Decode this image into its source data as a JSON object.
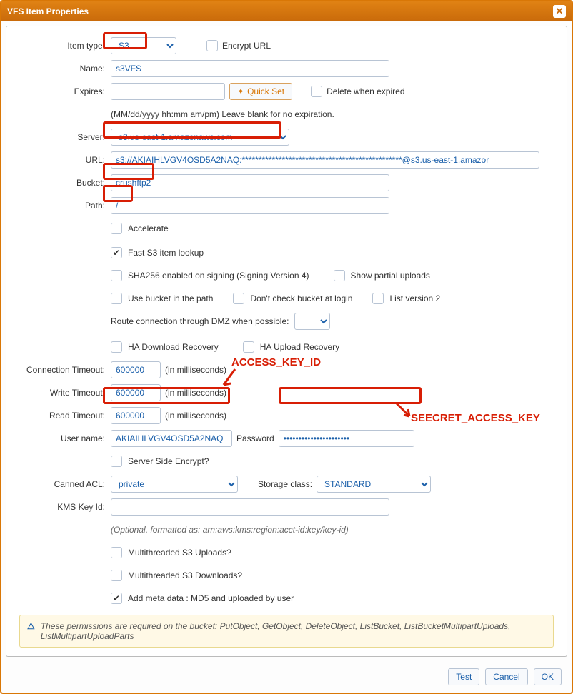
{
  "title": "VFS Item Properties",
  "labels": {
    "itemType": "Item type:",
    "name": "Name:",
    "expires": "Expires:",
    "server": "Server:",
    "url": "URL:",
    "bucket": "Bucket:",
    "path": "Path:",
    "connTimeout": "Connection Timeout:",
    "writeTimeout": "Write Timeout:",
    "readTimeout": "Read Timeout:",
    "username": "User name:",
    "password": "Password",
    "cannedAcl": "Canned ACL:",
    "storageClass": "Storage class:",
    "kmsKeyId": "KMS Key Id:",
    "dmz": "Route connection through DMZ when possible:"
  },
  "values": {
    "itemType": "S3",
    "name": "s3VFS",
    "expires": "",
    "expiresHint": "(MM/dd/yyyy hh:mm am/pm) Leave blank for no expiration.",
    "server": "s3.us-east-1.amazonaws.com",
    "url": "s3://AKIAIHLVGV4OSD5A2NAQ:************************************************@s3.us-east-1.amazor",
    "bucket": "crushftp2",
    "path": "/",
    "connTimeout": "600000",
    "writeTimeout": "600000",
    "readTimeout": "600000",
    "msHint": "(in milliseconds)",
    "username": "AKIAIHLVGV4OSD5A2NAQ",
    "password": "••••••••••••••••••••••",
    "cannedAcl": "private",
    "storageClass": "STANDARD",
    "kmsKeyId": "",
    "kmsHint": "(Optional, formatted as: arn:aws:kms:region:acct-id:key/key-id)"
  },
  "checks": {
    "encryptUrl": "Encrypt URL",
    "deleteExpired": "Delete when expired",
    "accelerate": "Accelerate",
    "fastLookup": "Fast S3 item lookup",
    "sha256": "SHA256 enabled on signing (Signing Version 4)",
    "showPartial": "Show partial uploads",
    "bucketInPath": "Use bucket in the path",
    "dontCheckBucket": "Don't check bucket at login",
    "listV2": "List version 2",
    "haDown": "HA Download Recovery",
    "haUp": "HA Upload Recovery",
    "serverSideEncrypt": "Server Side Encrypt?",
    "mtUploads": "Multithreaded S3 Uploads?",
    "mtDownloads": "Multithreaded S3 Downloads?",
    "addMeta": "Add meta data : MD5 and uploaded by user"
  },
  "buttons": {
    "quickSet": "Quick Set",
    "test": "Test",
    "cancel": "Cancel",
    "ok": "OK"
  },
  "alert": {
    "icon": "⚠",
    "text1": "These permissions are required on the bucket: ",
    "perms": "PutObject, GetObject, DeleteObject, ListBucket, ListBucketMultipartUploads, ListMultipartUploadParts"
  },
  "annotations": {
    "access": "ACCESS_KEY_ID",
    "secret": "SEECRET_ACCESS_KEY"
  }
}
